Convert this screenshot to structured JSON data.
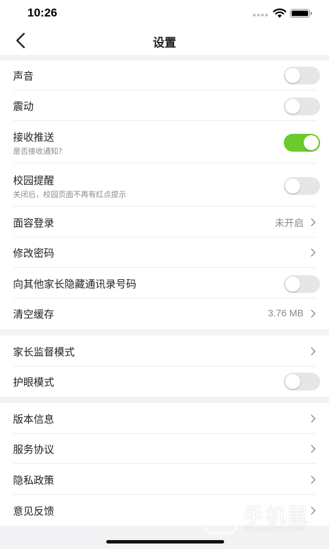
{
  "status_bar": {
    "time": "10:26"
  },
  "header": {
    "title": "设置"
  },
  "sections": [
    {
      "rows": [
        {
          "title": "声音",
          "type": "toggle",
          "on": false
        },
        {
          "title": "震动",
          "type": "toggle",
          "on": false
        },
        {
          "title": "接收推送",
          "subtitle": "是否接收通知?",
          "type": "toggle",
          "on": true
        },
        {
          "title": "校园提醒",
          "subtitle": "关闭后，校园页面不再有红点提示",
          "type": "toggle",
          "on": false
        },
        {
          "title": "面容登录",
          "value": "未开启",
          "type": "link"
        },
        {
          "title": "修改密码",
          "type": "link"
        },
        {
          "title": "向其他家长隐藏通讯录号码",
          "type": "toggle",
          "on": false
        },
        {
          "title": "清空缓存",
          "value": "3.76 MB",
          "type": "link"
        }
      ]
    },
    {
      "rows": [
        {
          "title": "家长监督模式",
          "type": "link"
        },
        {
          "title": "护眼模式",
          "type": "toggle",
          "on": false
        }
      ]
    },
    {
      "rows": [
        {
          "title": "版本信息",
          "type": "link"
        },
        {
          "title": "服务协议",
          "type": "link"
        },
        {
          "title": "隐私政策",
          "type": "link"
        },
        {
          "title": "意见反馈",
          "type": "link"
        }
      ]
    }
  ],
  "watermark": {
    "text": "手机鼠",
    "sub": "SHOUJISHU.COM"
  },
  "colors": {
    "toggle_on": "#6bcb2c",
    "toggle_off": "#e6e6e8",
    "page_bg": "#f3f3f5"
  }
}
